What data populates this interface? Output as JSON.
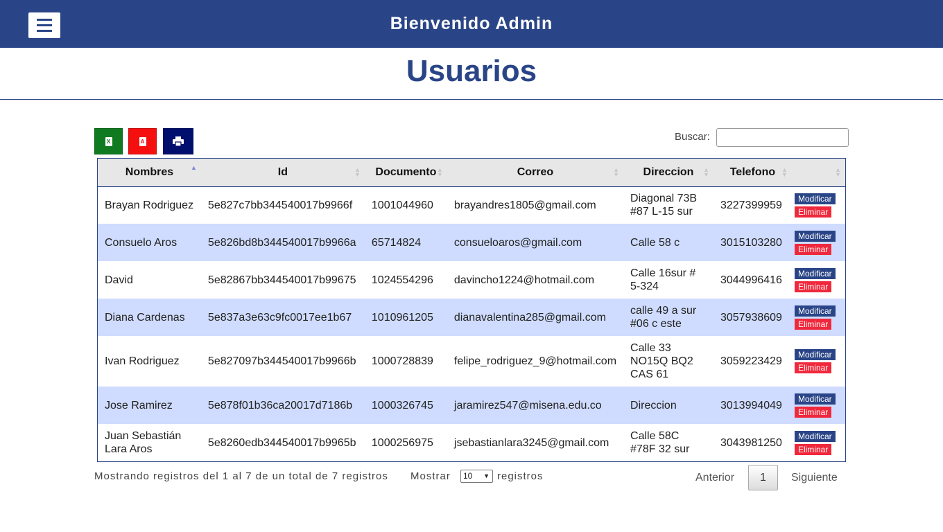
{
  "header": {
    "title": "Bienvenido Admin",
    "menu_icon": "hamburger-menu-icon"
  },
  "page": {
    "title": "Usuarios"
  },
  "toolbar": {
    "excel_icon": "excel-file-icon",
    "excel_letter": "X",
    "pdf_icon": "pdf-file-icon",
    "pdf_letter": "A",
    "print_icon": "printer-icon",
    "search_label": "Buscar:",
    "search_value": ""
  },
  "colors": {
    "header_bg": "#2a4587",
    "excel": "#0f7a1f",
    "pdf": "#f50f0f",
    "print": "#000e6e",
    "row_alt": "#cfdcff",
    "delete": "#f0283c"
  },
  "table": {
    "columns": [
      "Nombres",
      "Id",
      "Documento",
      "Correo",
      "Direccion",
      "Telefono",
      ""
    ],
    "sorted_column": "Nombres",
    "modify_label": "Modificar",
    "delete_label": "Eliminar",
    "rows": [
      {
        "nombres": "Brayan Rodriguez",
        "id": "5e827c7bb344540017b9966f",
        "documento": "1001044960",
        "correo": "brayandres1805@gmail.com",
        "direccion": "Diagonal 73B #87 L-15 sur",
        "telefono": "3227399959"
      },
      {
        "nombres": "Consuelo Aros",
        "id": "5e826bd8b344540017b9966a",
        "documento": "65714824",
        "correo": "consueloaros@gmail.com",
        "direccion": "Calle 58 c",
        "telefono": "3015103280"
      },
      {
        "nombres": "David",
        "id": "5e82867bb344540017b99675",
        "documento": "1024554296",
        "correo": "davincho1224@hotmail.com",
        "direccion": "Calle 16sur # 5-324",
        "telefono": "3044996416"
      },
      {
        "nombres": "Diana Cardenas",
        "id": "5e837a3e63c9fc0017ee1b67",
        "documento": "1010961205",
        "correo": "dianavalentina285@gmail.com",
        "direccion": "calle 49 a sur #06 c este",
        "telefono": "3057938609"
      },
      {
        "nombres": "Ivan Rodriguez",
        "id": "5e827097b344540017b9966b",
        "documento": "1000728839",
        "correo": "felipe_rodriguez_9@hotmail.com",
        "direccion": "Calle 33 NO15Q BQ2 CAS 61",
        "telefono": "3059223429"
      },
      {
        "nombres": "Jose Ramirez",
        "id": "5e878f01b36ca20017d7186b",
        "documento": "1000326745",
        "correo": "jaramirez547@misena.edu.co",
        "direccion": "Direccion",
        "telefono": "3013994049"
      },
      {
        "nombres": "Juan Sebastián Lara Aros",
        "id": "5e8260edb344540017b9965b",
        "documento": "1000256975",
        "correo": "jsebastianlara3245@gmail.com",
        "direccion": "Calle 58C #78F 32 sur",
        "telefono": "3043981250"
      }
    ]
  },
  "footer": {
    "info": "Mostrando registros del 1 al 7 de un total de 7 registros",
    "show_label": "Mostrar",
    "page_size": "10",
    "show_suffix": "registros",
    "prev_label": "Anterior",
    "current_page": "1",
    "next_label": "Siguiente"
  }
}
